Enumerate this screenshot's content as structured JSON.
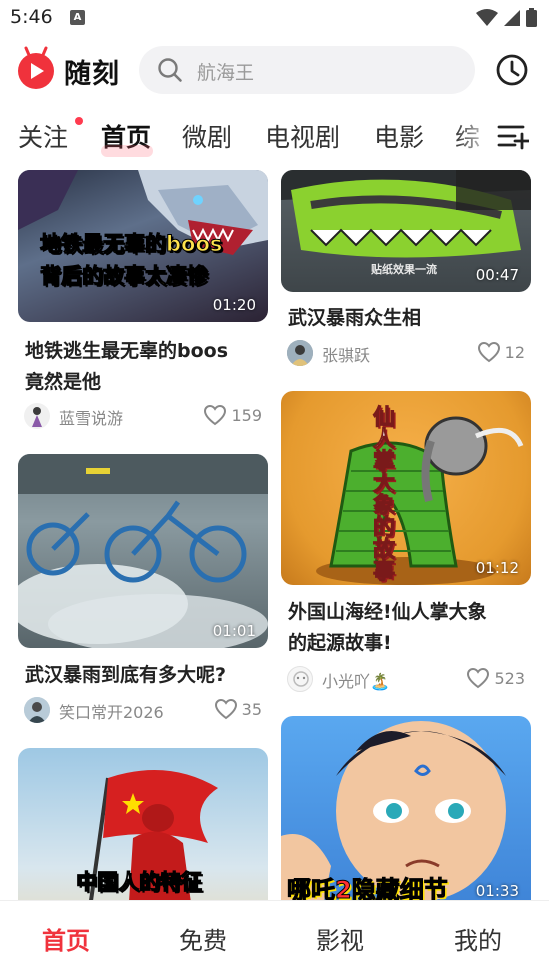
{
  "status_bar": {
    "time": "5:46",
    "notification_badge": "A"
  },
  "header": {
    "brand": "随刻",
    "brand_color": "#f0323c",
    "search_placeholder": "航海王"
  },
  "tabs": [
    {
      "label": "关注",
      "active": false,
      "has_dot": true
    },
    {
      "label": "首页",
      "active": true
    },
    {
      "label": "微剧",
      "active": false
    },
    {
      "label": "电视剧",
      "active": false
    },
    {
      "label": "电影",
      "active": false
    },
    {
      "label": "综",
      "active": false
    }
  ],
  "feed": {
    "left": [
      {
        "thumb_text_1": "地铁最无辜的boos",
        "thumb_text_2": "背后的故事太凄惨",
        "duration": "01:20",
        "title_line1": "地铁逃生最无辜的boos",
        "title_line2": "竟然是他",
        "author": "蓝雪说游",
        "likes": "159"
      },
      {
        "duration": "01:01",
        "title_line1": "武汉暴雨到底有多大呢?",
        "author": "笑口常开2026",
        "likes": "35"
      },
      {
        "thumb_text_1": "中国人的特征"
      }
    ],
    "right": [
      {
        "thumb_text_1": "贴纸效果一流",
        "duration": "00:47",
        "title_line1": "武汉暴雨众生相",
        "author": "张骐跃",
        "likes": "12"
      },
      {
        "thumb_text_1": "仙人掌大象的故事",
        "duration": "01:12",
        "title_line1": "外国山海经!仙人掌大象",
        "title_line2": "的起源故事!",
        "author": "小光吖🏝️",
        "likes": "523"
      },
      {
        "thumb_text_1": "哪吒2隐藏细节",
        "duration": "01:33"
      }
    ]
  },
  "bottom_nav": [
    {
      "label": "首页",
      "active": true
    },
    {
      "label": "免费",
      "active": false
    },
    {
      "label": "影视",
      "active": false
    },
    {
      "label": "我的",
      "active": false
    }
  ]
}
